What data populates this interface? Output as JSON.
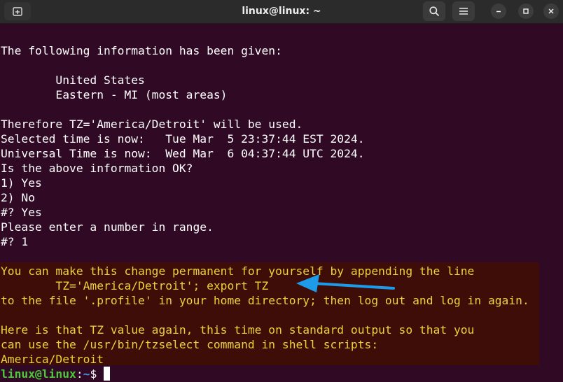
{
  "window": {
    "title": "linux@linux: ~"
  },
  "icons": {
    "new_tab": "new-tab-icon",
    "search": "search-icon",
    "menu": "hamburger-menu-icon",
    "minimize": "minimize-icon",
    "maximize": "maximize-icon",
    "close": "close-icon"
  },
  "colors": {
    "terminal_bg": "#300a24",
    "highlight_bg": "#3e0d08",
    "highlight_text": "#ebd23a",
    "prompt_user": "#4ec93a",
    "prompt_path": "#4f8fd8",
    "arrow": "#1e9be8"
  },
  "terminal": {
    "output_lines": [
      "The following information has been given:",
      "",
      "        United States",
      "        Eastern - MI (most areas)",
      "",
      "Therefore TZ='America/Detroit' will be used.",
      "Selected time is now:   Tue Mar  5 23:37:44 EST 2024.",
      "Universal Time is now:  Wed Mar  6 04:37:44 UTC 2024.",
      "Is the above information OK?",
      "1) Yes",
      "2) No",
      "#? Yes",
      "Please enter a number in range.",
      "#? 1"
    ],
    "highlighted_lines": [
      "You can make this change permanent for yourself by appending the line",
      "        TZ='America/Detroit'; export TZ",
      "to the file '.profile' in your home directory; then log out and log in again.",
      "",
      "Here is that TZ value again, this time on standard output so that you",
      "can use the /usr/bin/tzselect command in shell scripts:",
      "America/Detroit"
    ],
    "prompt": {
      "user": "linux@linux",
      "colon": ":",
      "path": "~",
      "symbol": "$ "
    }
  }
}
